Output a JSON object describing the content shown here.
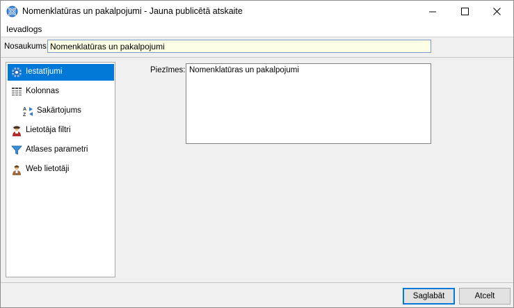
{
  "window": {
    "title": "Nomenklatūras un pakalpojumi - Jauna publicētā atskaite",
    "app_icon": "globe-icon",
    "controls": [
      "minimize-icon",
      "maximize-icon",
      "close-icon"
    ]
  },
  "menu": {
    "items": [
      {
        "label": "Ievadlogs"
      }
    ]
  },
  "form": {
    "name_label": "Nosaukums:",
    "name_value": "Nomenklatūras un pakalpojumi",
    "notes_label": "Piezīmes:",
    "notes_value": "Nomenklatūras un pakalpojumi"
  },
  "nav": {
    "items": [
      {
        "label": "Iestatījumi",
        "icon": "gear-icon",
        "selected": true
      },
      {
        "label": "Kolonnas",
        "icon": "columns-icon",
        "selected": false
      },
      {
        "label": "Sakārtojums",
        "icon": "sort-az-icon",
        "selected": false
      },
      {
        "label": "Lietotāja filtri",
        "icon": "user-filter-icon",
        "selected": false
      },
      {
        "label": "Atlases parametri",
        "icon": "funnel-icon",
        "selected": false
      },
      {
        "label": "Web lietotāji",
        "icon": "web-user-icon",
        "selected": false
      }
    ]
  },
  "buttons": {
    "save": "Saglabāt",
    "cancel": "Atcelt"
  },
  "colors": {
    "selection": "#0078d7",
    "input_bg": "#fdfde3",
    "window_bg": "#f0f0f0"
  }
}
